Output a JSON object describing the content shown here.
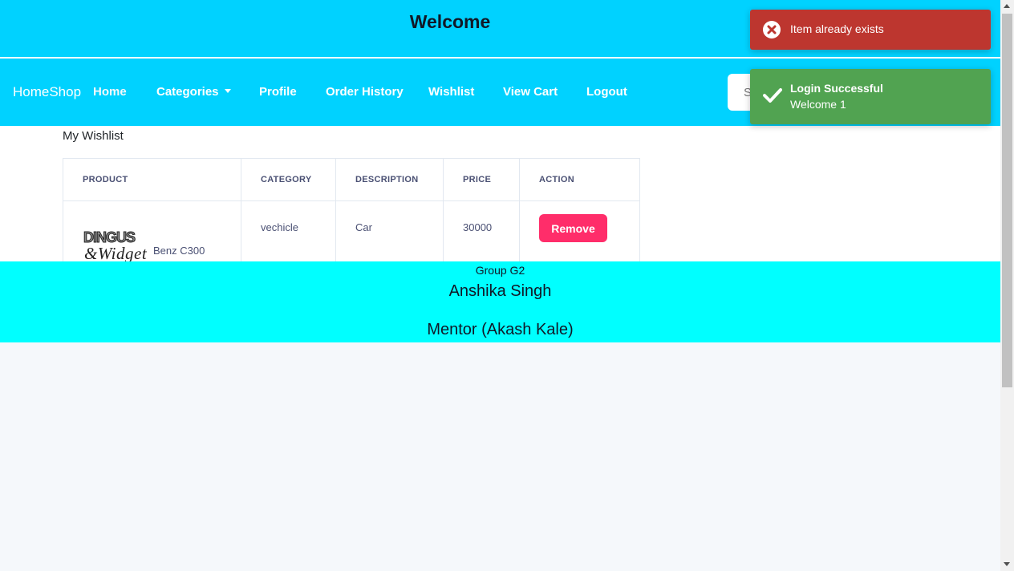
{
  "header": {
    "title": "Welcome"
  },
  "navbar": {
    "brand": "HomeShop",
    "items": [
      {
        "label": "Home"
      },
      {
        "label": "Categories"
      },
      {
        "label": "Profile"
      },
      {
        "label": "Order History"
      },
      {
        "label": "Wishlist"
      },
      {
        "label": "View Cart"
      },
      {
        "label": "Logout"
      }
    ],
    "search": {
      "placeholder": "Search"
    }
  },
  "wishlist": {
    "title": "My Wishlist",
    "columns": [
      "PRODUCT",
      "CATEGORY",
      "DESCRIPTION",
      "PRICE",
      "ACTION"
    ],
    "rows": [
      {
        "logo_text": "DINGUS & Widget",
        "product": "Benz C300",
        "category": "vechicle",
        "description": "Car",
        "price": "30000",
        "action": "Remove"
      }
    ]
  },
  "footer": {
    "group": "Group G2",
    "name": "Anshika Singh",
    "mentor": "Mentor (Akash Kale)"
  },
  "toasts": {
    "error": {
      "message": "Item already exists",
      "icon": "error-circle-icon",
      "color": "#bd362f"
    },
    "success": {
      "title": "Login Successful",
      "message": "Welcome 1",
      "icon": "checkmark-icon",
      "color": "#51a351"
    }
  },
  "colors": {
    "header_bg": "#00d2ff",
    "footer_bg": "#00ffff",
    "remove_button": "#ff2d6a"
  }
}
